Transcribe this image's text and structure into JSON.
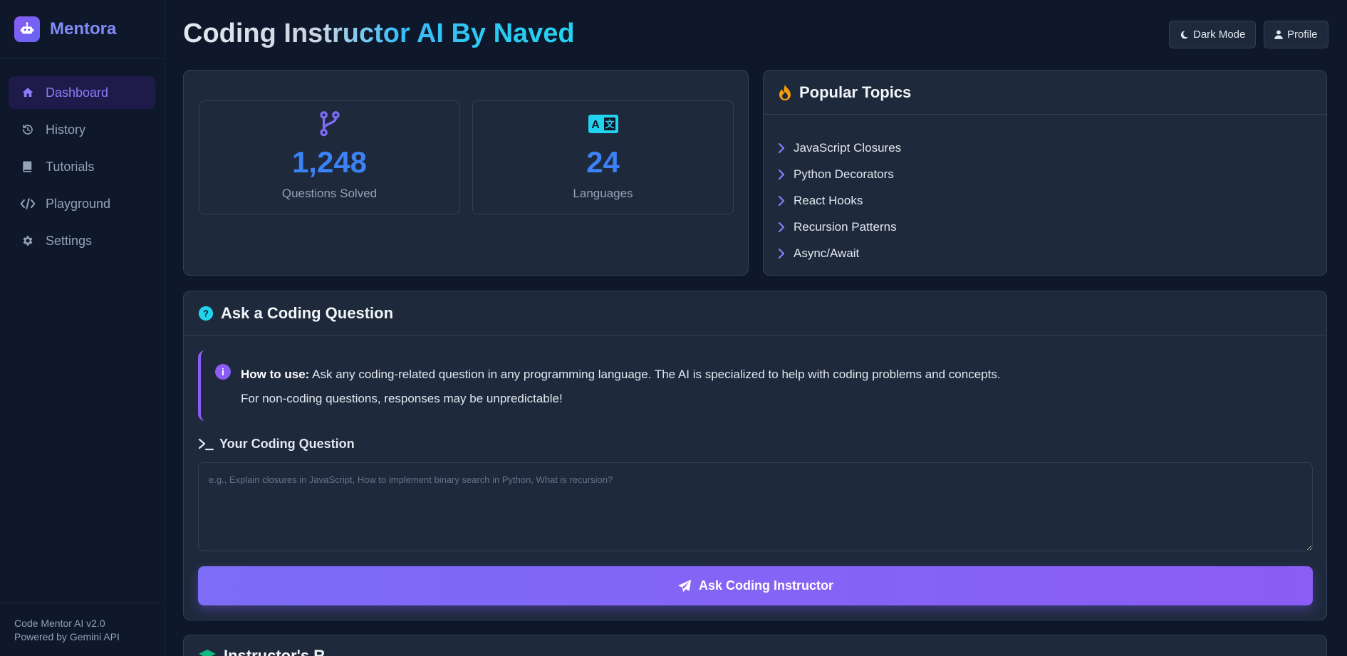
{
  "brand": {
    "name": "Mentora",
    "icon": "robot-icon"
  },
  "sidebar": {
    "items": [
      {
        "label": "Dashboard",
        "icon": "home-icon",
        "active": true
      },
      {
        "label": "History",
        "icon": "history-icon",
        "active": false
      },
      {
        "label": "Tutorials",
        "icon": "book-icon",
        "active": false
      },
      {
        "label": "Playground",
        "icon": "code-icon",
        "active": false
      },
      {
        "label": "Settings",
        "icon": "gear-icon",
        "active": false
      }
    ],
    "footer": {
      "version": "Code Mentor AI v2.0",
      "powered": "Powered by Gemini API"
    }
  },
  "header": {
    "title": "Coding Instructor AI By Naved",
    "dark_mode_label": "Dark Mode",
    "profile_label": "Profile"
  },
  "stats": [
    {
      "value": "1,248",
      "label": "Questions Solved",
      "icon": "code-branch-icon"
    },
    {
      "value": "24",
      "label": "Languages",
      "icon": "language-icon"
    }
  ],
  "topics": {
    "title": "Popular Topics",
    "icon": "fire-icon",
    "items": [
      "JavaScript Closures",
      "Python Decorators",
      "React Hooks",
      "Recursion Patterns",
      "Async/Await"
    ]
  },
  "ask": {
    "title": "Ask a Coding Question",
    "icon": "question-circle-icon",
    "info_bold": "How to use:",
    "info_text": "Ask any coding-related question in any programming language. The AI is specialized to help with coding problems and concepts.",
    "info_text_2": "For non-coding questions, responses may be unpredictable!",
    "question_label": "Your Coding Question",
    "placeholder": "e.g., Explain closures in JavaScript, How to implement binary search in Python, What is recursion?",
    "button_label": "Ask Coding Instructor"
  },
  "response": {
    "title": "Instructor's R"
  },
  "colors": {
    "accent": "#8b5cf6",
    "stat_value": "#3b82f6",
    "background": "#0f172a",
    "card": "#1e293b"
  }
}
